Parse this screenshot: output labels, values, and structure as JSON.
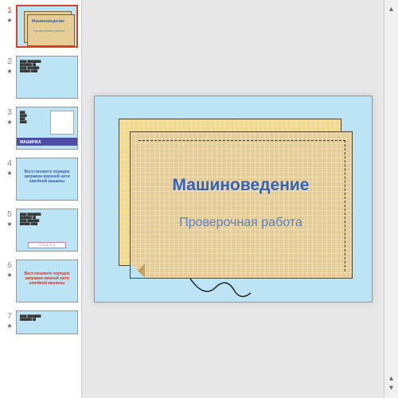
{
  "sidebar": {
    "thumbs": [
      {
        "num": "1",
        "active": true
      },
      {
        "num": "2",
        "active": false
      },
      {
        "num": "3",
        "active": false,
        "label": "МАШИНКА"
      },
      {
        "num": "4",
        "active": false,
        "title": "Восстановите порядок заправки верхней нити швейной машины",
        "titleColor": "#3a5fb5"
      },
      {
        "num": "5",
        "active": false
      },
      {
        "num": "6",
        "active": false,
        "title": "Восстановите порядок заправки нижней нити швейной машины",
        "titleColor": "#c04020"
      },
      {
        "num": "7",
        "active": false
      }
    ]
  },
  "slide": {
    "title": "Машиноведение",
    "subtitle": "Проверочная работа"
  }
}
